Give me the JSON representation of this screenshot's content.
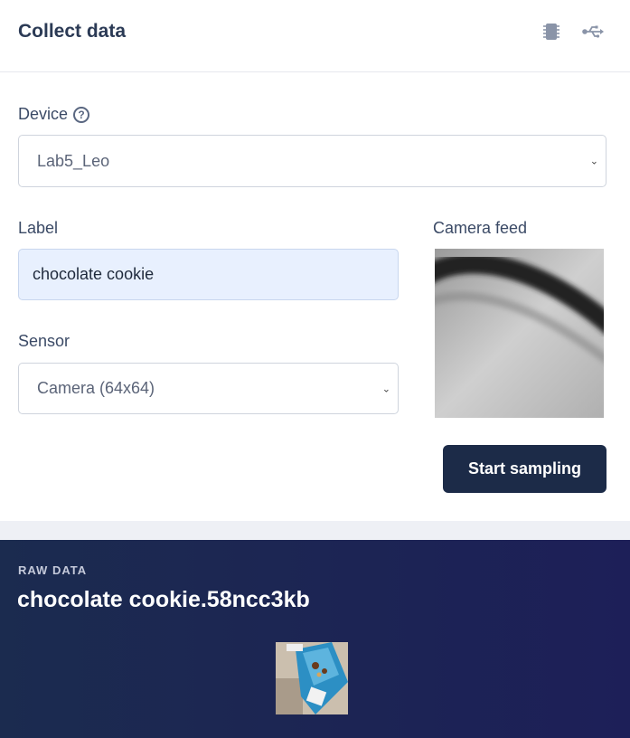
{
  "header": {
    "title": "Collect data",
    "icons": [
      "chip-icon",
      "usb-icon"
    ]
  },
  "device": {
    "label": "Device",
    "help_glyph": "?",
    "selected": "Lab5_Leo"
  },
  "label_field": {
    "label": "Label",
    "value": "chocolate cookie"
  },
  "sensor": {
    "label": "Sensor",
    "selected": "Camera (64x64)"
  },
  "camera_feed": {
    "label": "Camera feed"
  },
  "actions": {
    "start_sampling": "Start sampling"
  },
  "raw_data": {
    "caption": "RAW DATA",
    "title": "chocolate cookie.58ncc3kb"
  },
  "colors": {
    "primary_button": "#1c2b48",
    "raw_panel_start": "#1b2b4f",
    "raw_panel_end": "#1d1f58",
    "input_highlight": "#e8f0fe"
  }
}
